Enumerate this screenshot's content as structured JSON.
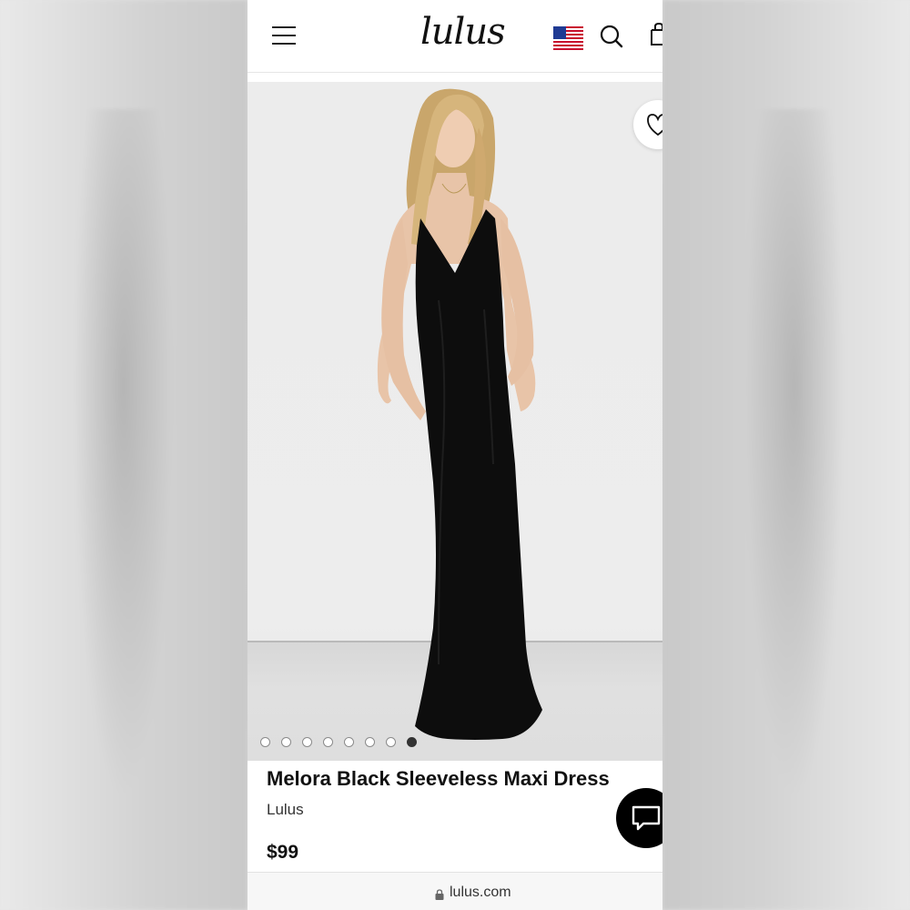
{
  "header": {
    "logo_text": "lulus",
    "menu_icon": "hamburger-menu-icon",
    "flag_icon": "us-flag-icon",
    "search_icon": "search-icon",
    "bag_icon": "shopping-bag-icon"
  },
  "gallery": {
    "image_count": 8,
    "active_index": 7,
    "wishlist_icon": "heart-icon"
  },
  "product": {
    "title": "Melora Black Sleeveless Maxi Dress",
    "brand": "Lulus",
    "price": "$99"
  },
  "chat": {
    "icon": "chat-bubble-icon"
  },
  "browser": {
    "url": "lulus.com",
    "lock_icon": "lock-icon"
  },
  "colors": {
    "dress": "#0d0d0d",
    "background": "#ececec",
    "chat_button": "#000000"
  }
}
